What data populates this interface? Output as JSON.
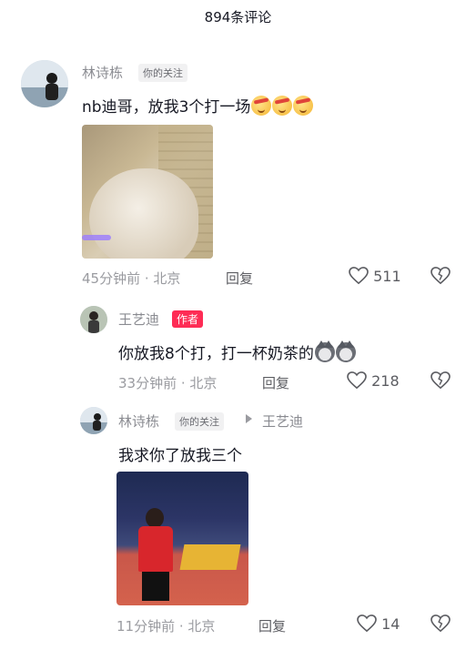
{
  "header": {
    "title": "894条评论"
  },
  "comments": [
    {
      "user": "林诗栋",
      "tag": "你的关注",
      "text": "nb迪哥，放我3个打一场",
      "emojis": [
        "smile-emoji",
        "smile-emoji",
        "smile-emoji"
      ],
      "time": "45分钟前 · 北京",
      "reply": "回复",
      "likes": "511"
    },
    {
      "user": "王艺迪",
      "tag": "作者",
      "text": "你放我8个打，打一杯奶茶的",
      "emojis": [
        "dog-emoji",
        "dog-emoji"
      ],
      "time": "33分钟前 · 北京",
      "reply": "回复",
      "likes": "218"
    },
    {
      "user": "林诗栋",
      "tag": "你的关注",
      "reply_to": "王艺迪",
      "text": "我求你了放我三个",
      "time": "11分钟前 · 北京",
      "reply": "回复",
      "likes": "14"
    }
  ],
  "colors": {
    "author_tag": "#fe2c55",
    "meta": "#9a9ba0",
    "username": "#8a8b91"
  }
}
